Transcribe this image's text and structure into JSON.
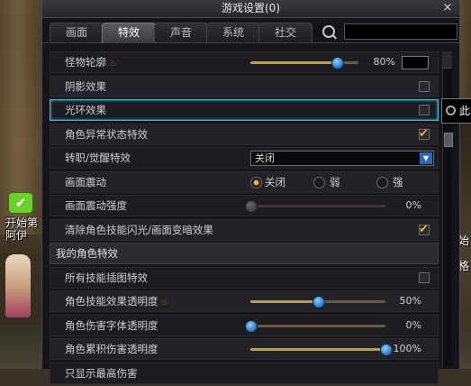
{
  "window": {
    "title": "游戏设置(0)",
    "close_label": "×"
  },
  "tabs": [
    {
      "label": "画面"
    },
    {
      "label": "特效"
    },
    {
      "label": "声音"
    },
    {
      "label": "系统"
    },
    {
      "label": "社交"
    }
  ],
  "active_tab": "特效",
  "search": {
    "placeholder": "",
    "value": ""
  },
  "rows": {
    "monster_outline": {
      "label": "怪物轮廓",
      "value_label": "80%",
      "value": 80
    },
    "shadow": {
      "label": "阴影效果",
      "checked": false
    },
    "aura": {
      "label": "光环效果",
      "checked": false
    },
    "abnormal": {
      "label": "角色异常状态特效",
      "checked": true
    },
    "awaken": {
      "label": "转职/觉醒特效",
      "selected": "关闭"
    },
    "shake": {
      "label": "画面震动",
      "options": [
        "关闭",
        "弱",
        "强"
      ],
      "selected": "关闭"
    },
    "shake_strength": {
      "label": "画面震动强度",
      "value_label": "0%",
      "value": 0
    },
    "clear_flash": {
      "label": "清除角色技能闪光/画面变暗效果",
      "checked": true
    },
    "section_my": {
      "label": "我的角色特效"
    },
    "skill_art": {
      "label": "所有技能插图特效",
      "checked": false
    },
    "skill_opacity": {
      "label": "角色技能效果透明度",
      "value_label": "50%",
      "value": 50
    },
    "dmg_font_opacity": {
      "label": "角色伤害字体透明度",
      "value_label": "0%",
      "value": 0
    },
    "cumulative_dmg": {
      "label": "角色累积伤害透明度",
      "value_label": "100%",
      "value": 100
    },
    "max_dmg_only": {
      "label": "只显示最高伤害"
    }
  },
  "tooltip": {
    "text": "此"
  },
  "scene": {
    "npc_badge": "✔",
    "npc_name_line1": "开始第",
    "npc_name_line2": "阿伊",
    "right_text1": "开始",
    "right_text2": "格"
  },
  "colors": {
    "accent": "#48b8e0",
    "check": "#f0b030",
    "badge": "#6ccf2c",
    "knob": "#2a70b8"
  }
}
